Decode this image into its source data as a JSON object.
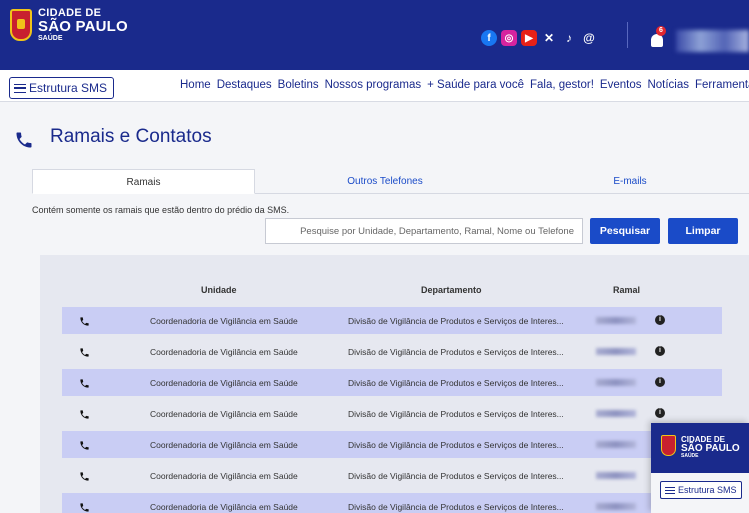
{
  "brand": {
    "line1": "CIDADE DE",
    "line2": "SÃO PAULO",
    "line3": "SAÚDE"
  },
  "header": {
    "socials": [
      "facebook-icon",
      "instagram-icon",
      "youtube-icon",
      "x-icon",
      "tiktok-icon",
      "threads-icon"
    ],
    "notification_count": "6"
  },
  "nav": {
    "menu_label": "Estrutura SMS",
    "links": [
      "Home",
      "Destaques",
      "Boletins",
      "Nossos programas",
      "+ Saúde para você",
      "Fala, gestor!",
      "Eventos",
      "Notícias",
      "Ferramentas"
    ]
  },
  "page": {
    "title": "Ramais e Contatos"
  },
  "tabs": [
    "Ramais",
    "Outros Telefones",
    "E-mails"
  ],
  "info_text": "Contém somente os ramais que estão dentro do prédio da SMS.",
  "search": {
    "placeholder": "Pesquise por Unidade, Departamento, Ramal, Nome ou Telefone",
    "search_label": "Pesquisar",
    "clear_label": "Limpar"
  },
  "table": {
    "columns": [
      "Unidade",
      "Departamento",
      "Ramal"
    ],
    "rows": [
      {
        "unidade": "Coordenadoria de Vigilância em Saúde",
        "departamento": "Divisão de Vigilância de Produtos e Serviços de Interes..."
      },
      {
        "unidade": "Coordenadoria de Vigilância em Saúde",
        "departamento": "Divisão de Vigilância de Produtos e Serviços de Interes..."
      },
      {
        "unidade": "Coordenadoria de Vigilância em Saúde",
        "departamento": "Divisão de Vigilância de Produtos e Serviços de Interes..."
      },
      {
        "unidade": "Coordenadoria de Vigilância em Saúde",
        "departamento": "Divisão de Vigilância de Produtos e Serviços de Interes..."
      },
      {
        "unidade": "Coordenadoria de Vigilância em Saúde",
        "departamento": "Divisão de Vigilância de Produtos e Serviços de Interes..."
      },
      {
        "unidade": "Coordenadoria de Vigilância em Saúde",
        "departamento": "Divisão de Vigilância de Produtos e Serviços de Interes..."
      },
      {
        "unidade": "Coordenadoria de Vigilância em Saúde",
        "departamento": "Divisão de Vigilância de Produtos e Serviços de Interes..."
      }
    ]
  },
  "mini_overlay": {
    "line1": "CIDADE DE",
    "line2": "SÃO PAULO",
    "line3": "SAÚDE",
    "menu_label": "Estrutura SMS"
  }
}
